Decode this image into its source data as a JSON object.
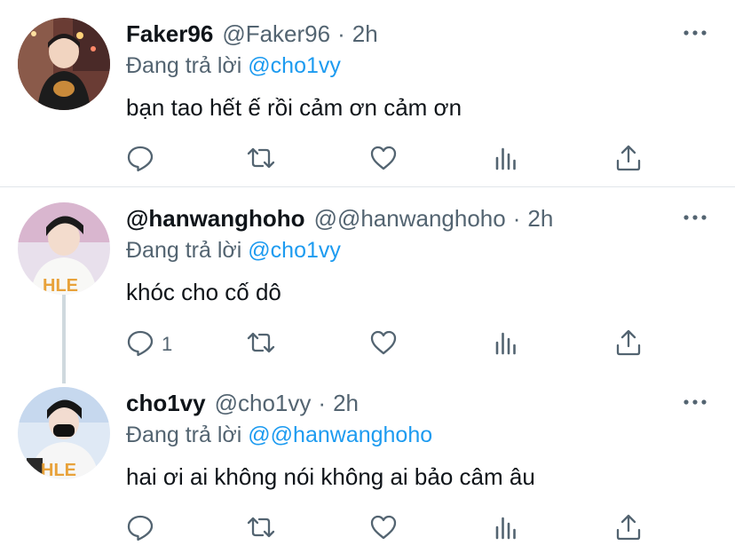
{
  "colors": {
    "accent": "#1d9bf0",
    "secondary_text": "#536471",
    "primary_text": "#0f1419"
  },
  "icons": [
    "reply-icon",
    "retweet-icon",
    "like-icon",
    "analytics-icon",
    "share-icon",
    "more-icon"
  ],
  "tweets": [
    {
      "name": "Faker96",
      "handle": "@Faker96",
      "dot": "·",
      "time": "2h",
      "reply_prefix": "Đang trả lời",
      "reply_to": "@cho1vy",
      "text": "bạn tao hết ế rồi cảm ơn cảm ơn",
      "reply_count": ""
    },
    {
      "name": "@hanwanghoho",
      "handle": "@@hanwanghoho",
      "dot": "·",
      "time": "2h",
      "reply_prefix": "Đang trả lời",
      "reply_to": "@cho1vy",
      "text": "khóc cho cố dô",
      "reply_count": "1"
    },
    {
      "name": "cho1vy",
      "handle": "@cho1vy",
      "dot": "·",
      "time": "2h",
      "reply_prefix": "Đang trả lời",
      "reply_to": "@@hanwanghoho",
      "text": "hai ơi ai không nói không ai bảo câm âu",
      "reply_count": ""
    }
  ]
}
